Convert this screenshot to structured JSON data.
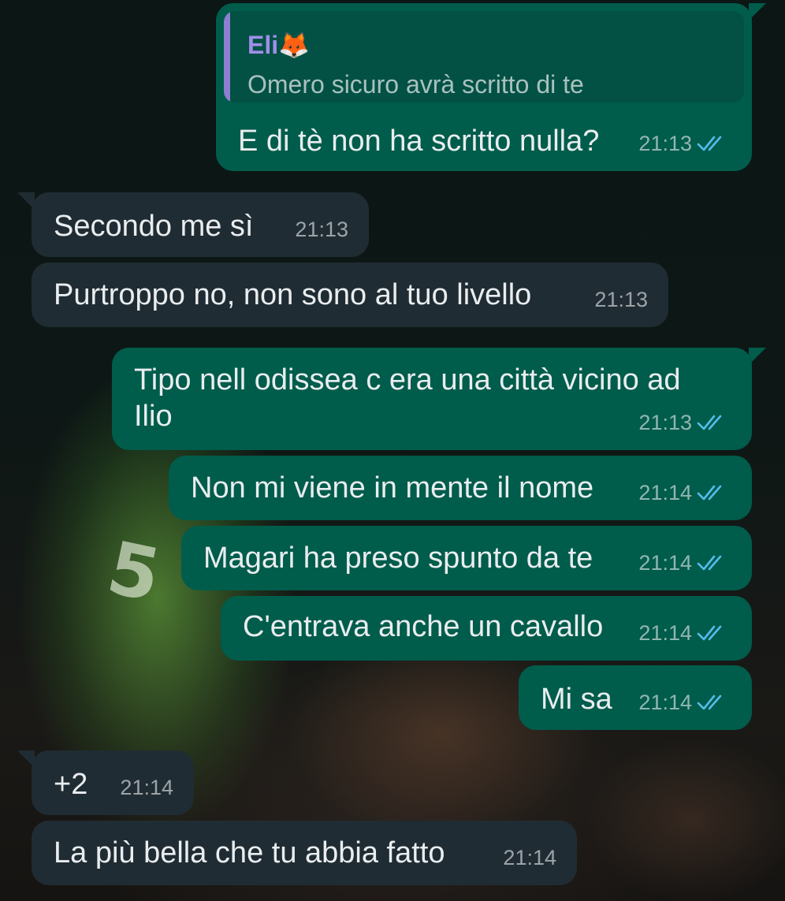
{
  "chat": {
    "messages": [
      {
        "direction": "outgoing",
        "reply_to": {
          "author": "Eli🦊",
          "text": "Omero sicuro avrà scritto di te"
        },
        "text": "E di tè non ha scritto nulla?",
        "time": "21:13",
        "status": "read"
      },
      {
        "direction": "incoming",
        "text": "Secondo me sì",
        "time": "21:13"
      },
      {
        "direction": "incoming",
        "text": "Purtroppo no, non sono al tuo livello",
        "time": "21:13"
      },
      {
        "direction": "outgoing",
        "text_lines": [
          "Tipo nell odissea c era una città vicino ad",
          "Ilio"
        ],
        "time": "21:13",
        "status": "read"
      },
      {
        "direction": "outgoing",
        "text": "Non mi viene in mente il nome",
        "time": "21:14",
        "status": "read"
      },
      {
        "direction": "outgoing",
        "text": "Magari ha preso spunto da te",
        "time": "21:14",
        "status": "read"
      },
      {
        "direction": "outgoing",
        "text": "C'entrava anche un cavallo",
        "time": "21:14",
        "status": "read"
      },
      {
        "direction": "outgoing",
        "text": "Mi sa",
        "time": "21:14",
        "status": "read"
      },
      {
        "direction": "incoming",
        "text": "+2",
        "time": "21:14"
      },
      {
        "direction": "incoming",
        "text": "La più bella che tu abbia fatto",
        "time": "21:14"
      }
    ]
  },
  "wallpaper": {
    "jersey_number": "5"
  },
  "icons": {
    "read_receipt": "double-check-icon"
  },
  "colors": {
    "outgoing_bubble": "#005c4b",
    "incoming_bubble": "#202c33",
    "read_tick": "#53bdeb",
    "quote_author": "#9f8fe8"
  }
}
